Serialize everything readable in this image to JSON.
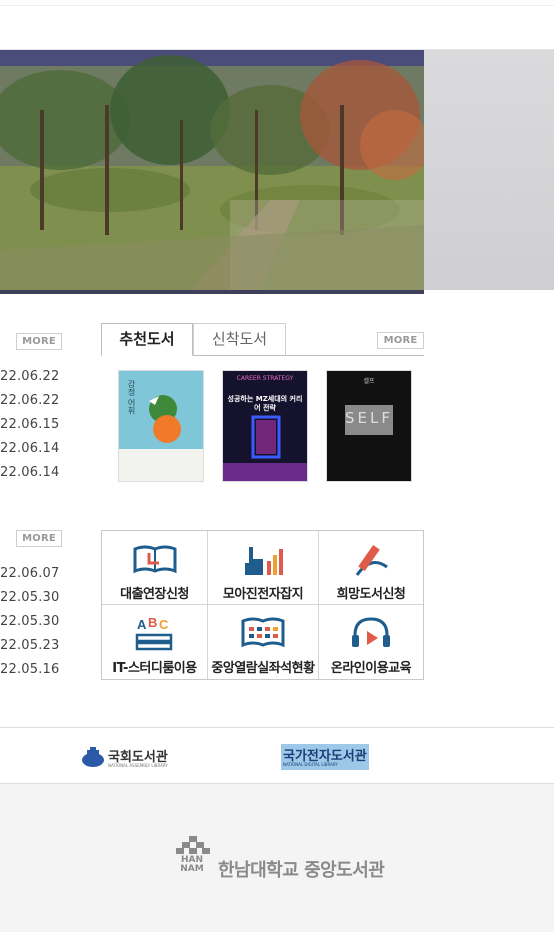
{
  "notices": {
    "more_label": "MORE",
    "dates": [
      "22.06.22",
      "22.06.22",
      "22.06.15",
      "22.06.14",
      "22.06.14"
    ]
  },
  "books": {
    "tabs": [
      {
        "label": "추천도서",
        "active": true
      },
      {
        "label": "신착도서",
        "active": false
      }
    ],
    "more_label": "MORE",
    "items": [
      {
        "title_text": "감정 어휘",
        "cover_color": "#7ec6d8"
      },
      {
        "title_text": "성공하는 MZ세대의 커리어 전략",
        "top_text": "CAREER STRATEGY",
        "cover_color": "#15122e"
      },
      {
        "title_text": "SELF",
        "top_text": "셀프",
        "cover_color": "#111111"
      }
    ]
  },
  "events": {
    "more_label": "MORE",
    "dates": [
      "22.06.07",
      "22.05.30",
      "22.05.30",
      "22.05.23",
      "22.05.16"
    ]
  },
  "services": [
    {
      "label": "대출연장신청",
      "icon": "book-clock-icon"
    },
    {
      "label": "모아진전자잡지",
      "icon": "hand-chart-icon"
    },
    {
      "label": "희망도서신청",
      "icon": "pencil-icon"
    },
    {
      "label": "IT-스터디룸이용",
      "icon": "abc-books-icon"
    },
    {
      "label": "중앙열람실좌석현황",
      "icon": "seat-book-icon"
    },
    {
      "label": "온라인이용교육",
      "icon": "headphones-icon"
    }
  ],
  "partner_links": {
    "nal_label": "국회도서관",
    "nal_sub": "NATIONAL ASSEMBLY LIBRARY",
    "ndl_label": "국가전자도서관",
    "ndl_sub": "NATIONAL DIGITAL LIBRARY"
  },
  "footer": {
    "logo_mark": "HAN NAM",
    "library_name": "한남대학교 중앙도서관"
  },
  "colors": {
    "hero_border": "#3e3f5a",
    "icon_blue": "#1f5d8c",
    "icon_red": "#e05a4a",
    "icon_orange": "#f0a030",
    "ndl_bg": "#9ec8e8"
  }
}
